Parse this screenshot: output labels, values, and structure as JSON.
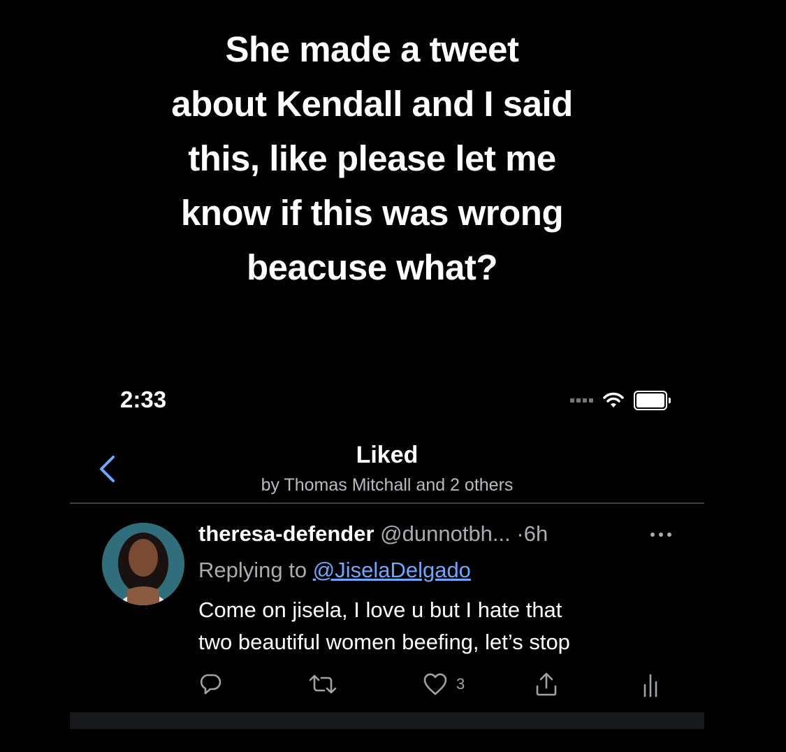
{
  "caption": {
    "lines": [
      "She made a tweet",
      "about Kendall and I said",
      "this, like please let me",
      "know if this was wrong",
      "beacuse what?"
    ]
  },
  "status_bar": {
    "time": "2:33",
    "icons": [
      "signal-icon",
      "wifi-icon",
      "battery-icon"
    ]
  },
  "nav": {
    "back_icon": "chevron-left-icon",
    "title": "Liked",
    "subtitle": "by Thomas Mitchall and 2 others"
  },
  "tweet": {
    "name": "theresa-defender",
    "handle": "@dunnotbh...",
    "time": "·6h",
    "replying_prefix": "Replying to",
    "replying_to": "@JiselaDelgado",
    "text_lines": [
      "Come on jisela, I love u but I hate that",
      "two beautiful women beefing, let’s stop"
    ],
    "actions": {
      "reply_icon": "reply-icon",
      "retweet_icon": "retweet-icon",
      "like_icon": "heart-icon",
      "like_count": "3",
      "share_icon": "share-icon",
      "stats_icon": "analytics-icon"
    }
  },
  "colors": {
    "background": "#000000",
    "link": "#6aa9ff",
    "muted": "#a9adb2"
  }
}
